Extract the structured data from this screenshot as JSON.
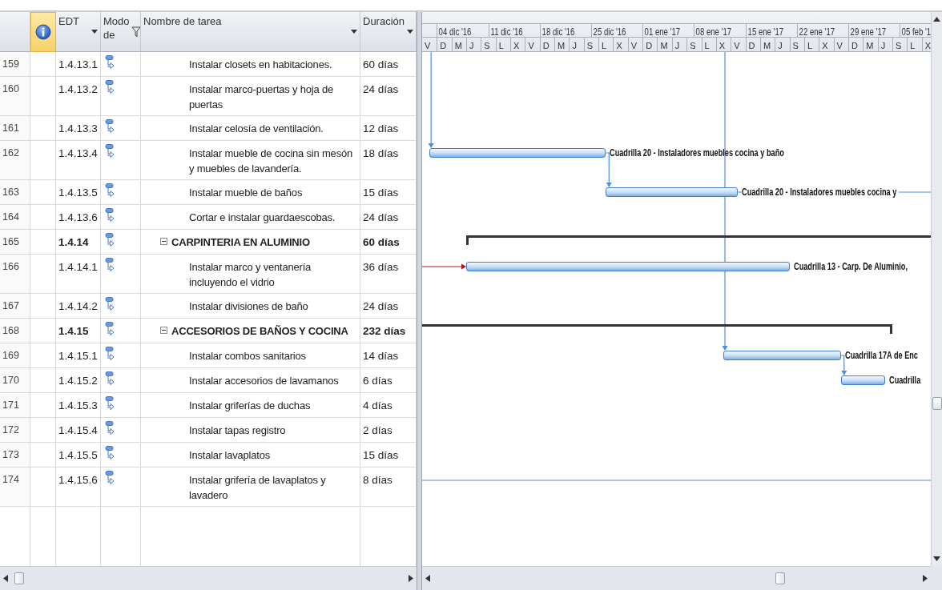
{
  "table": {
    "columns": [
      {
        "kind": "rownum",
        "selected": false
      },
      {
        "kind": "indicators",
        "selected": true
      },
      {
        "kind": "field",
        "label": "EDT",
        "dropdown": true,
        "filter": false,
        "selected": false
      },
      {
        "kind": "field",
        "label": "Modo de",
        "dropdown": false,
        "filter": true,
        "selected": false
      },
      {
        "kind": "field",
        "label": "Nombre de tarea",
        "dropdown": true,
        "filter": false,
        "selected": false
      },
      {
        "kind": "field",
        "label": "Duración",
        "dropdown": true,
        "filter": false,
        "selected": false
      }
    ],
    "rows": [
      {
        "id": "159",
        "edt": "1.4.13.1",
        "name": "Instalar closets en habitaciones.",
        "duration": "60 días",
        "summary": false
      },
      {
        "id": "160",
        "edt": "1.4.13.2",
        "name": "Instalar marco-puertas y hoja de puertas",
        "duration": "24 días",
        "summary": false
      },
      {
        "id": "161",
        "edt": "1.4.13.3",
        "name": "Instalar celosía de ventilación.",
        "duration": "12 días",
        "summary": false
      },
      {
        "id": "162",
        "edt": "1.4.13.4",
        "name": "Instalar mueble de cocina sin mesón y muebles de lavandería.",
        "duration": "18 días",
        "summary": false,
        "bar": {
          "label": "Cuadrilla 20 - Instaladores muebles cocina y baño"
        }
      },
      {
        "id": "163",
        "edt": "1.4.13.5",
        "name": "Instalar mueble de baños",
        "duration": "15 días",
        "summary": false,
        "bar": {
          "label": "Cuadrilla 20 - Instaladores muebles cocina y"
        }
      },
      {
        "id": "164",
        "edt": "1.4.13.6",
        "name": "Cortar e instalar guardaescobas.",
        "duration": "24 días",
        "summary": false
      },
      {
        "id": "165",
        "edt": "1.4.14",
        "name": "CARPINTERIA EN ALUMINIO",
        "duration": "60 días",
        "summary": true,
        "expanded": true
      },
      {
        "id": "166",
        "edt": "1.4.14.1",
        "name": "Instalar marco y ventanería incluyendo el vidrio",
        "duration": "36 días",
        "summary": false,
        "bar": {
          "label": "Cuadrilla 13 - Carp. De Aluminio,"
        }
      },
      {
        "id": "167",
        "edt": "1.4.14.2",
        "name": "Instalar divisiones de baño",
        "duration": "24 días",
        "summary": false
      },
      {
        "id": "168",
        "edt": "1.4.15",
        "name": "ACCESORIOS DE BAÑOS Y COCINA",
        "duration": "232 días",
        "summary": true,
        "expanded": true
      },
      {
        "id": "169",
        "edt": "1.4.15.1",
        "name": "Instalar combos sanitarios",
        "duration": "14 días",
        "summary": false,
        "bar": {
          "label": "Cuadrilla 17A de Enc"
        }
      },
      {
        "id": "170",
        "edt": "1.4.15.2",
        "name": "Instalar accesorios de lavamanos",
        "duration": "6 días",
        "summary": false,
        "bar": {
          "label": "Cuadrilla"
        }
      },
      {
        "id": "171",
        "edt": "1.4.15.3",
        "name": "Instalar griferías de duchas",
        "duration": "4 días",
        "summary": false
      },
      {
        "id": "172",
        "edt": "1.4.15.4",
        "name": "Instalar tapas registro",
        "duration": "2 días",
        "summary": false
      },
      {
        "id": "173",
        "edt": "1.4.15.5",
        "name": "Instalar lavaplatos",
        "duration": "15 días",
        "summary": false
      },
      {
        "id": "174",
        "edt": "1.4.15.6",
        "name": "Instalar grifería de lavaplatos y lavadero",
        "duration": "8 días",
        "summary": false
      }
    ]
  },
  "gantt": {
    "timescale": {
      "weeks": [
        "04 dic '16",
        "11 dic '16",
        "18 dic '16",
        "25 dic '16",
        "01 ene '17",
        "08 ene '17",
        "15 ene '17",
        "22 ene '17",
        "29 ene '17",
        "05 feb '1"
      ],
      "days": [
        "V",
        "D",
        "M",
        "J",
        "S",
        "L",
        "X",
        "V",
        "D",
        "M",
        "J",
        "S",
        "L",
        "X",
        "V",
        "D",
        "M",
        "J",
        "S",
        "L",
        "X",
        "V",
        "D",
        "M",
        "J",
        "S",
        "L",
        "X",
        "V",
        "D",
        "M",
        "J",
        "S",
        "L",
        "X"
      ]
    }
  }
}
